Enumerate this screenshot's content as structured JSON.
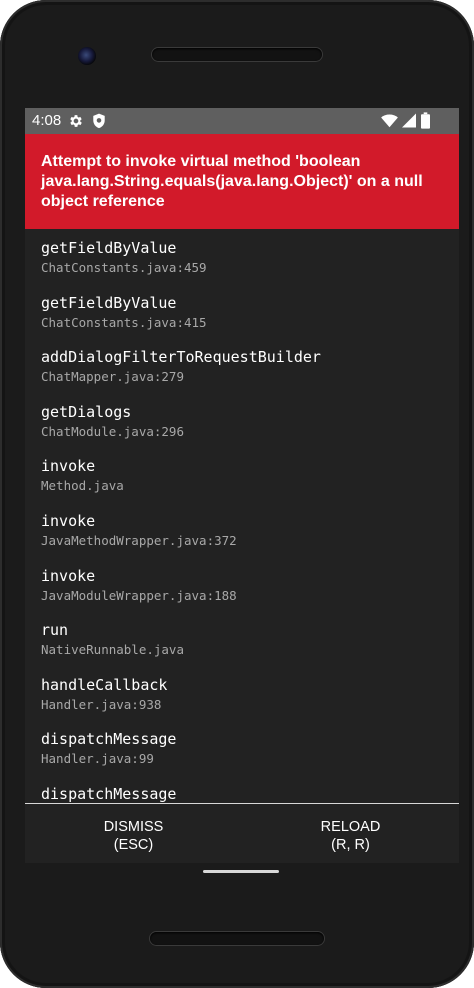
{
  "status_bar": {
    "time": "4:08",
    "icons": [
      "gear-icon",
      "shield-icon",
      "wifi-icon",
      "signal-icon",
      "battery-icon"
    ]
  },
  "error": {
    "message": "Attempt to invoke virtual method 'boolean java.lang.String.equals(java.lang.Object)' on a null object reference"
  },
  "stack": [
    {
      "method": "getFieldByValue",
      "file": "ChatConstants.java:459"
    },
    {
      "method": "getFieldByValue",
      "file": "ChatConstants.java:415"
    },
    {
      "method": "addDialogFilterToRequestBuilder",
      "file": "ChatMapper.java:279"
    },
    {
      "method": "getDialogs",
      "file": "ChatModule.java:296"
    },
    {
      "method": "invoke",
      "file": "Method.java"
    },
    {
      "method": "invoke",
      "file": "JavaMethodWrapper.java:372"
    },
    {
      "method": "invoke",
      "file": "JavaModuleWrapper.java:188"
    },
    {
      "method": "run",
      "file": "NativeRunnable.java"
    },
    {
      "method": "handleCallback",
      "file": "Handler.java:938"
    },
    {
      "method": "dispatchMessage",
      "file": "Handler.java:99"
    },
    {
      "method": "dispatchMessage",
      "file": ""
    }
  ],
  "actions": {
    "dismiss": {
      "label": "DISMISS",
      "hint": "(ESC)"
    },
    "reload": {
      "label": "RELOAD",
      "hint": "(R, R)"
    }
  },
  "colors": {
    "error_banner": "#d21a2a",
    "screen_background": "#222222",
    "status_bar": "#5f5f5f",
    "file_text": "#a8a8a8"
  }
}
